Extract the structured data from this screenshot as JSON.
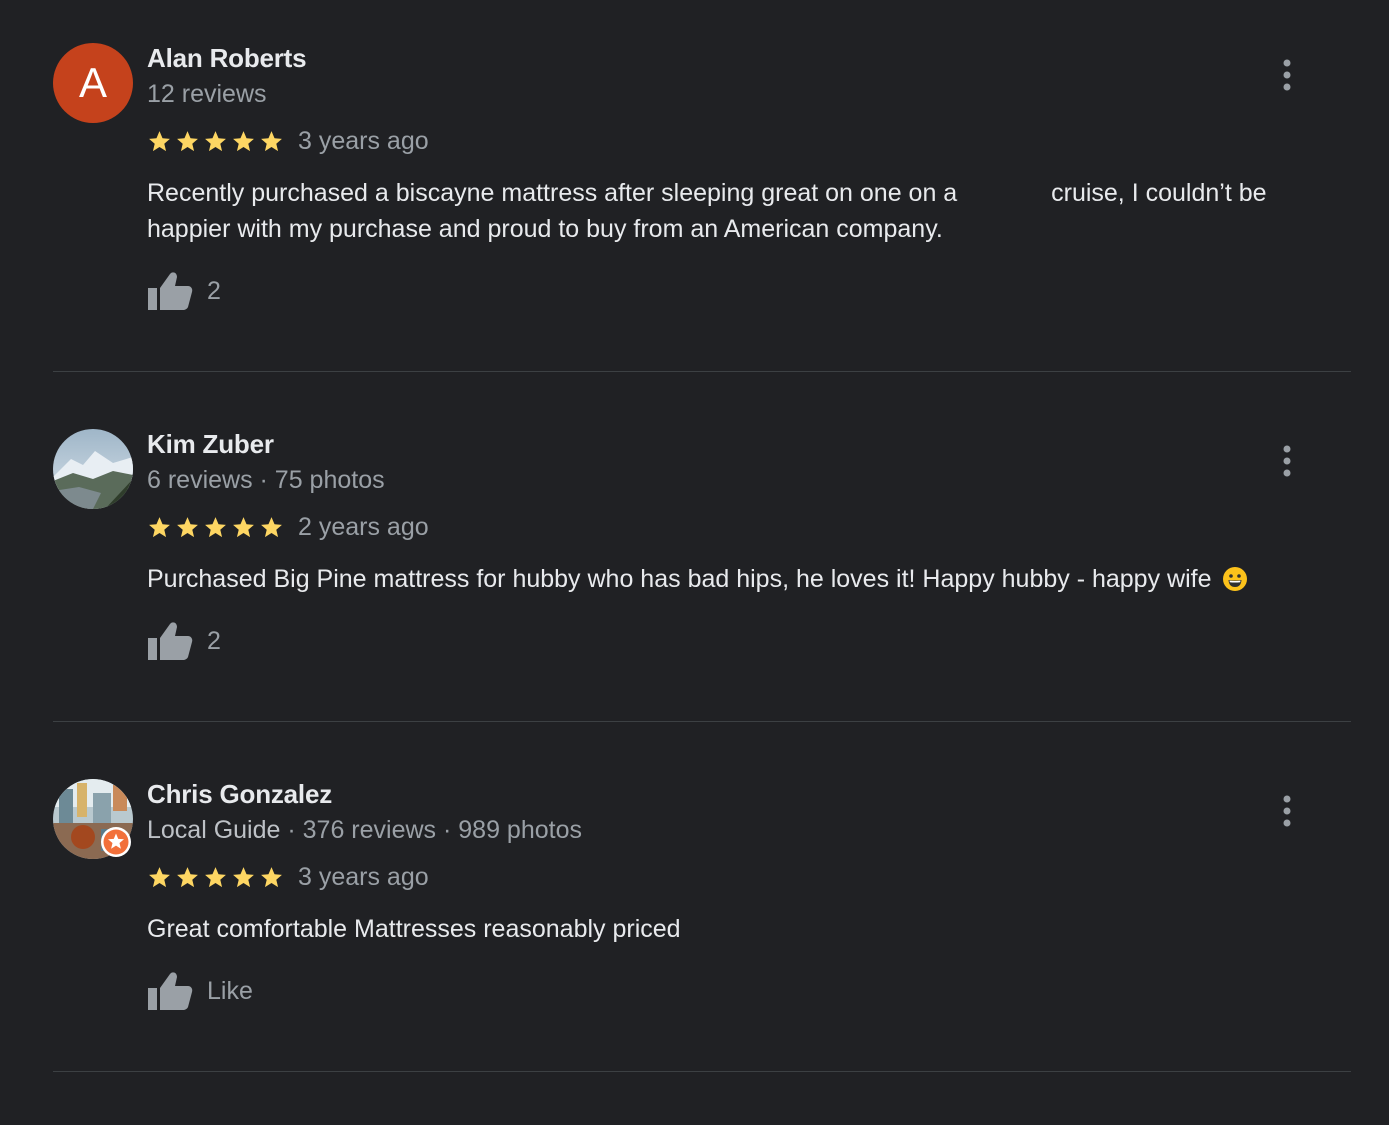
{
  "reviews": [
    {
      "name": "Alan Roberts",
      "avatar_letter": "A",
      "avatar_color": "#c5421c",
      "meta": "12 reviews",
      "rating": 5,
      "ago": "3 years ago",
      "text_before": "Recently purchased a biscayne mattress after sleeping great on one on a",
      "text_after": "cruise, I couldn’t be happier with my purchase and proud to buy from an American company.",
      "likes": "2"
    },
    {
      "name": "Kim Zuber",
      "meta": "6 reviews · 75 photos",
      "rating": 5,
      "ago": "2 years ago",
      "text": "Purchased Big Pine mattress for hubby who has bad hips, he loves it!  Happy hubby - happy wife",
      "likes": "2"
    },
    {
      "name": "Chris Gonzalez",
      "meta_guide": "Local Guide",
      "meta": " · 376 reviews · 989 photos",
      "rating": 5,
      "ago": "3 years ago",
      "text": "Great comfortable Mattresses reasonably priced",
      "likes": "Like"
    }
  ],
  "icons": {
    "star": "star-icon",
    "like": "thumb-up-icon",
    "more": "more-vert-icon"
  },
  "colors": {
    "background": "#202124",
    "star": "#fdd663",
    "name": "#e8eaed",
    "secondary": "#9aa0a6",
    "divider": "#3c4043"
  }
}
